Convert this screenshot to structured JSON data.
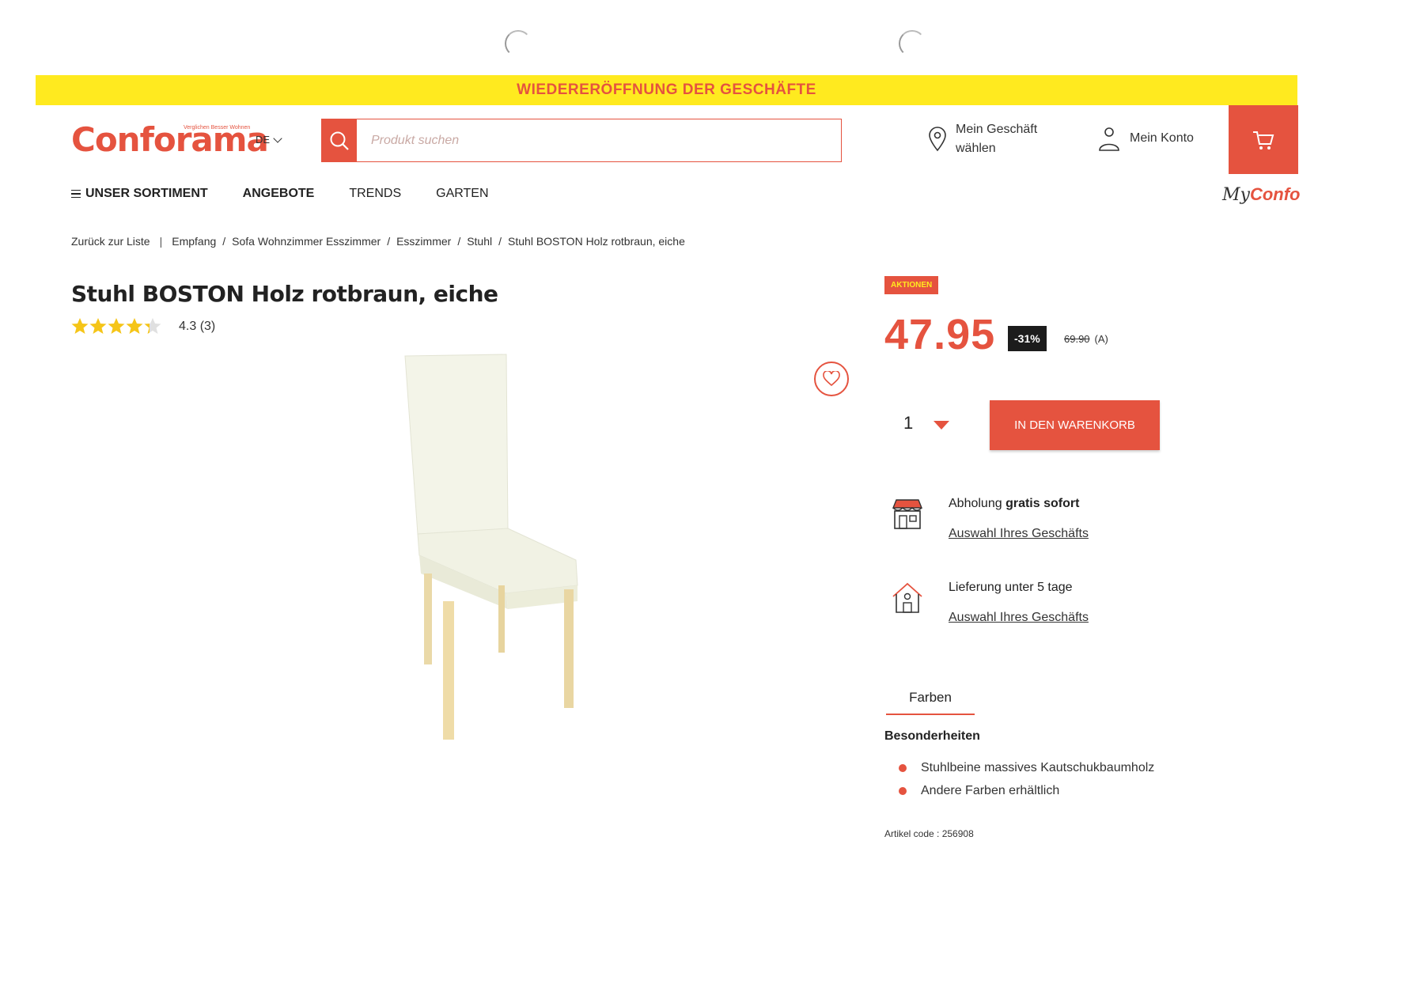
{
  "promo": {
    "text": "WIEDERERÖFFNUNG DER GESCHÄFTE"
  },
  "header": {
    "logo": "Conforama",
    "logo_tagline": "Verglichen Besser Wohnen",
    "lang": "DE",
    "search_placeholder": "Produkt suchen",
    "store_label": "Mein Geschäft wählen",
    "account_label": "Mein Konto",
    "colors": {
      "accent": "#e5533f",
      "promo_bg": "#ffea1f"
    }
  },
  "nav": {
    "items": [
      "UNSER SORTIMENT",
      "ANGEBOTE",
      "TRENDS",
      "GARTEN"
    ],
    "myconfo_my": "My",
    "myconfo_confo": "Confo"
  },
  "breadcrumb": {
    "back": "Zurück zur Liste",
    "items": [
      "Empfang",
      "Sofa Wohnzimmer Esszimmer",
      "Esszimmer",
      "Stuhl",
      "Stuhl BOSTON Holz rotbraun, eiche"
    ]
  },
  "product": {
    "title": "Stuhl BOSTON Holz rotbraun, eiche",
    "rating_value": 4.3,
    "rating_text": "4.3 (3)",
    "badge": "AKTIONEN",
    "price": "47.95",
    "discount": "-31%",
    "old_price": "69.90",
    "old_price_suffix": "(A)",
    "qty": "1",
    "add_to_cart": "IN DEN WARENKORB"
  },
  "services": [
    {
      "icon": "store-icon",
      "title_prefix": "Abholung ",
      "title_bold": "gratis sofort",
      "link": "Auswahl Ihres Geschäfts"
    },
    {
      "icon": "home-delivery-icon",
      "title_prefix": "Lieferung unter 5 tage",
      "title_bold": "",
      "link": "Auswahl Ihres Geschäfts"
    }
  ],
  "details": {
    "tab": "Farben",
    "section_title": "Besonderheiten",
    "features": [
      "Stuhlbeine massives Kautschukbaumholz",
      "Andere Farben erhältlich"
    ],
    "article_code": "Artikel code : 256908"
  }
}
